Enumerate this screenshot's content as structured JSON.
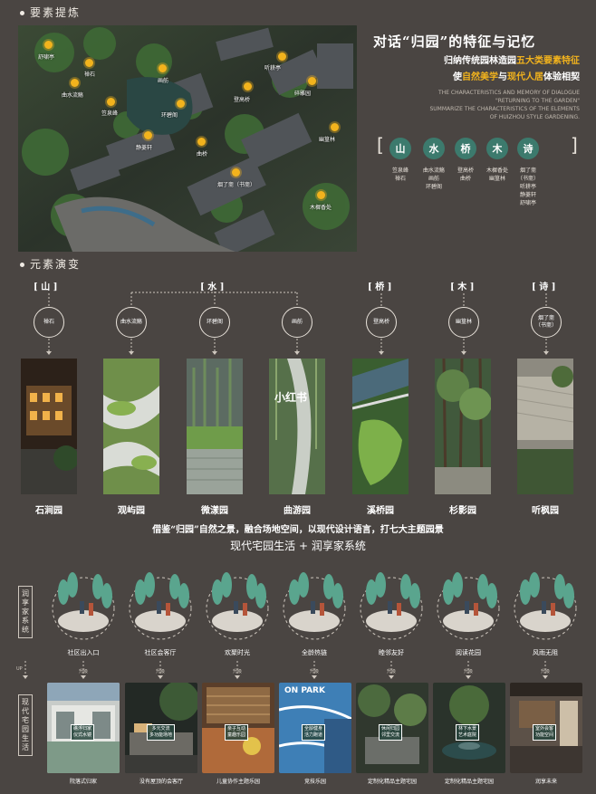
{
  "section1": {
    "heading": "要素提炼",
    "markers": [
      {
        "label": "舒啸亭"
      },
      {
        "label": "禅石"
      },
      {
        "label": "曲水流觞"
      },
      {
        "label": "画舫"
      },
      {
        "label": "笠泉峰"
      },
      {
        "label": "听耕亭"
      },
      {
        "label": "登高桥"
      },
      {
        "label": "碎雕园"
      },
      {
        "label": "环碧阁"
      },
      {
        "label": "静菱轩"
      },
      {
        "label": "曲桥"
      },
      {
        "label": "幽篁林"
      },
      {
        "label": "烟了斋（书斋）"
      },
      {
        "label": "木樨香处"
      }
    ],
    "title": "对话“归园”的特征与记忆",
    "line1": {
      "a": "归纳传统园林造园",
      "b": "五大类要素特征"
    },
    "line2": {
      "a": "使",
      "b": "自然美学",
      "c": "与",
      "d": "现代人居",
      "e": "体验相契"
    },
    "english": [
      "THE CHARACTERISTICS AND MEMORY OF DIALOGUE",
      "\"RETURNING TO THE GARDEN\"",
      "SUMMARIZE THE CHARACTERISTICS OF THE ELEMENTS",
      "OF HUIZHOU STYLE GARDENING."
    ],
    "keywords": [
      {
        "char": "山",
        "sub": "笠泉峰\n禅石"
      },
      {
        "char": "水",
        "sub": "曲水流觞\n画舫\n环碧阁"
      },
      {
        "char": "桥",
        "sub": "登高桥\n曲桥"
      },
      {
        "char": "木",
        "sub": "木樨香处\n幽篁林"
      },
      {
        "char": "诗",
        "sub": "烟了斋\n（书斋）\n听耕亭\n静菱轩\n舒啸亭"
      }
    ]
  },
  "section2": {
    "heading": "元素演变",
    "categories": [
      "[ 山 ]",
      "[ 水 ]",
      "[ 桥 ]",
      "[ 木 ]",
      "[ 诗 ]"
    ],
    "nodes": [
      "禅石",
      "曲水流觞",
      "环碧阁",
      "画舫",
      "登高桥",
      "幽篁林",
      "烟了斋\n（书斋）"
    ],
    "gardens": [
      "石涧园",
      "观屿园",
      "微漾园",
      "曲游园",
      "溪桥园",
      "杉影园",
      "听枫园"
    ],
    "watermark": "小红书",
    "statement": "借鉴“归园”自然之景，融合场地空间，以现代设计语言，打七大主题园景",
    "subtitle": "现代宅园生活 + 润享家系统"
  },
  "section3": {
    "side_top": "润享家系统",
    "side_bottom": "现代宅园生活",
    "up_left": "UP",
    "illustrations": [
      "社区出入口",
      "社区会客厅",
      "欢聚时光",
      "全龄热链",
      "睦邻友好",
      "阅读花园",
      "风雨无阻"
    ],
    "up_label": "升级",
    "photos": [
      {
        "caption": "院落式归家",
        "tag": "礁浮归家\n仪式水镜"
      },
      {
        "caption": "没有屋顶的会客厅",
        "tag": "多元交流\n多功能场地"
      },
      {
        "caption": "儿童协作主题乐园",
        "tag": "亲子互动\n童趣乐园"
      },
      {
        "caption": "竞技乐园",
        "tag": "全龄健身\n活力跑道"
      },
      {
        "caption": "定制化精品主题宅园",
        "tag": "休闲归园\n邻里交流"
      },
      {
        "caption": "定制化精品主题宅园",
        "tag": "林下水景\n艺术庭院"
      },
      {
        "caption": "润享未来",
        "tag": "室外会客\n功能空间"
      }
    ],
    "photo_text": "ON PARK"
  },
  "colors": {
    "bg": "#4a4542",
    "accent": "#f2b31d",
    "teal": "#3c7a6d"
  }
}
